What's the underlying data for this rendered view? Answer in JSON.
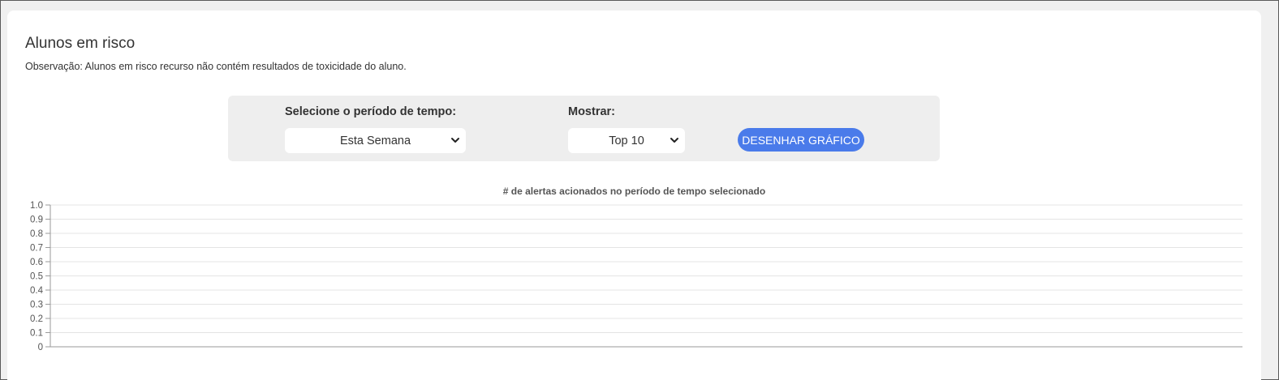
{
  "panel": {
    "title": "Alunos em risco",
    "note": "Observação: Alunos em risco recurso não contém resultados de toxicidade do aluno."
  },
  "controls": {
    "period_label": "Selecione o período de tempo:",
    "period_value": "Esta Semana",
    "show_label": "Mostrar:",
    "show_value": "Top 10",
    "draw_button": "DESENHAR GRÁFICO"
  },
  "colors": {
    "accent": "#4a7bea",
    "controls_bg": "#eeeeee",
    "grid": "#e4e4e4"
  },
  "chart_data": {
    "type": "bar",
    "title": "# de alertas acionados no período de tempo selecionado",
    "categories": [],
    "series": [],
    "ylim": [
      0,
      1
    ],
    "yticks": [
      "0",
      "0.1",
      "0.2",
      "0.3",
      "0.4",
      "0.5",
      "0.6",
      "0.7",
      "0.8",
      "0.9",
      "1.0"
    ],
    "grid": true
  }
}
